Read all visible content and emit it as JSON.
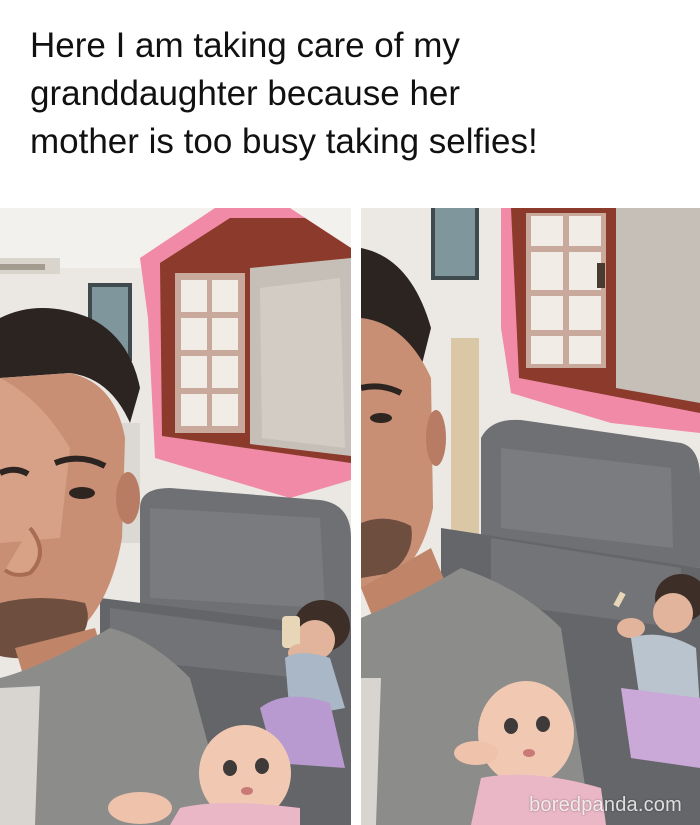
{
  "caption": {
    "lines": [
      "Here I am taking care of my",
      "granddaughter because her",
      "mother is too busy taking selfies!"
    ]
  },
  "photos": [
    {
      "name": "selfie-left",
      "subject": "man selfie with baby doll; granddaughter on sofa taking selfie with phone"
    },
    {
      "name": "selfie-right",
      "subject": "man selfie closer; granddaughter on sofa holding phone up"
    }
  ],
  "watermark": "boredpanda.com",
  "colors": {
    "wall": "#e9e6e3",
    "window_trim_pink": "#f08aa6",
    "window_frame": "#8b3a2b",
    "sofa": "#6f7174",
    "shirt": "#8c8c8a",
    "skin": "#c98f74",
    "hair": "#2b2420",
    "doll": "#f1c9b3"
  }
}
